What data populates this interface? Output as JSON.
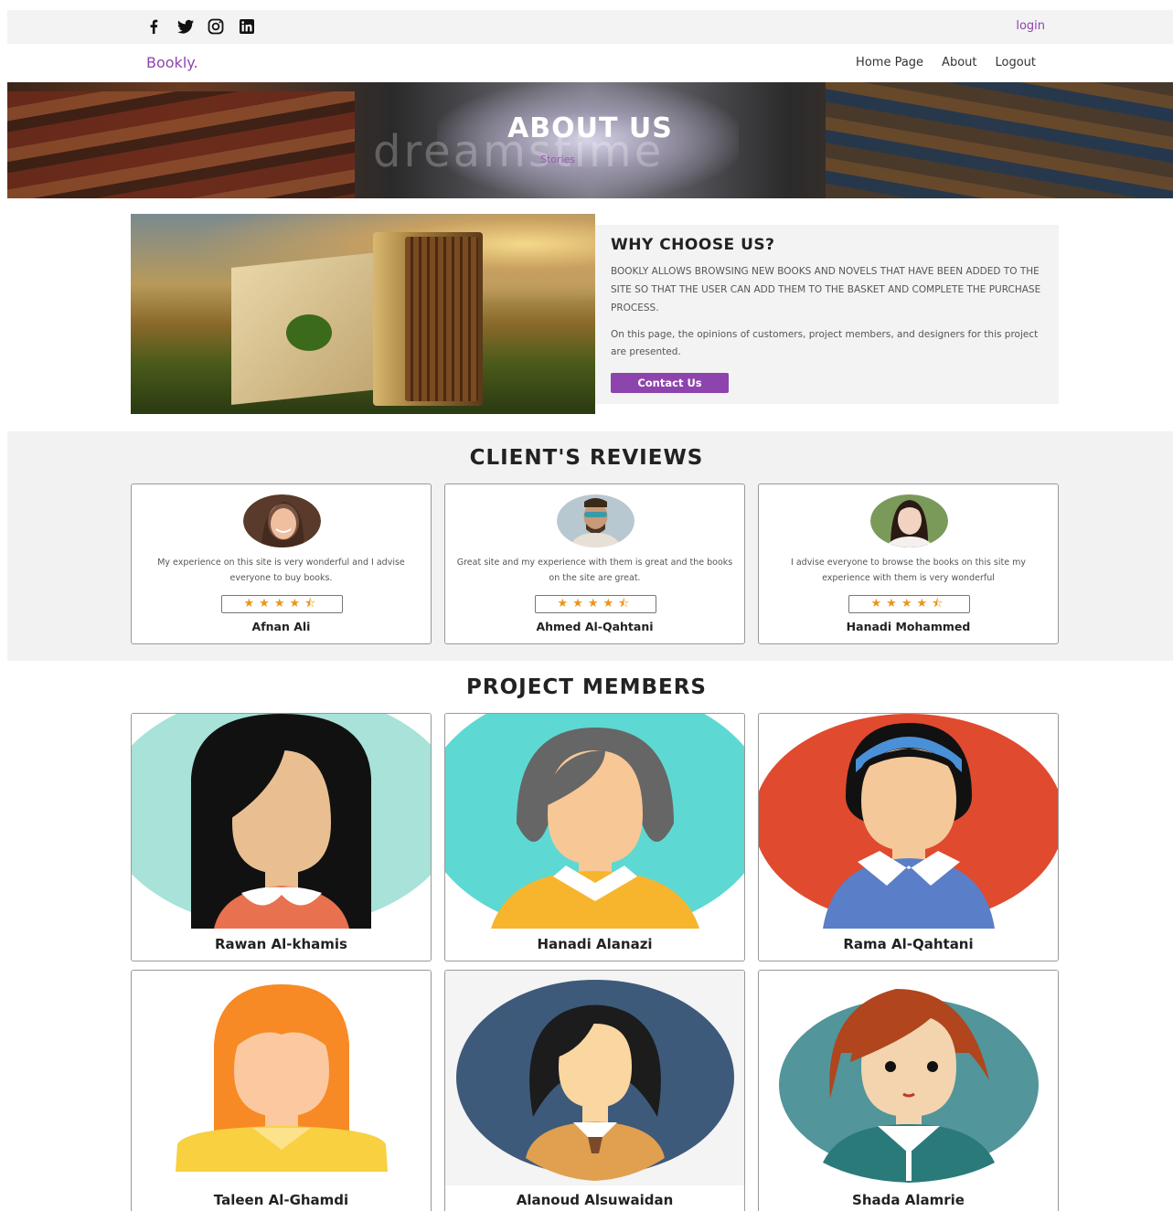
{
  "topbar": {
    "social_icons": [
      "facebook-icon",
      "twitter-icon",
      "instagram-icon",
      "linkedin-icon"
    ],
    "login_label": "login"
  },
  "nav": {
    "brand": "Bookly.",
    "links": [
      "Home Page",
      "About",
      "Logout"
    ]
  },
  "hero": {
    "title": "ABOUT US",
    "watermark": "dreamstime",
    "breadcrumb": "Stories"
  },
  "why": {
    "heading": "WHY CHOOSE US?",
    "paragraph1": "BOOKLY ALLOWS BROWSING NEW BOOKS AND NOVELS THAT HAVE BEEN ADDED TO THE SITE SO THAT THE USER CAN ADD THEM TO THE BASKET AND COMPLETE THE PURCHASE PROCESS.",
    "paragraph2": "On this page, the opinions of customers, project members, and designers for this project are presented.",
    "button_label": "Contact Us"
  },
  "reviews": {
    "heading": "CLIENT'S REVIEWS",
    "items": [
      {
        "text": "My experience on this site is very wonderful and I advise everyone to buy books.",
        "stars": "★★★★⯪",
        "rating": 4.5,
        "name": "Afnan Ali"
      },
      {
        "text": "Great site and my experience with them is great and the books on the site are great.",
        "stars": "★★★★⯪",
        "rating": 4.5,
        "name": "Ahmed Al-Qahtani"
      },
      {
        "text": "I advise everyone to browse the books on this site my experience with them is very wonderful",
        "stars": "★★★★⯪",
        "rating": 4.5,
        "name": "Hanadi Mohammed"
      }
    ]
  },
  "members": {
    "heading": "PROJECT MEMBERS",
    "items": [
      {
        "name": "Rawan Al-khamis"
      },
      {
        "name": "Hanadi Alanazi"
      },
      {
        "name": "Rama Al-Qahtani"
      },
      {
        "name": "Taleen Al-Ghamdi"
      },
      {
        "name": "Alanoud Alsuwaidan"
      },
      {
        "name": "Shada Alamrie"
      }
    ]
  },
  "colors": {
    "accent": "#8e44ad",
    "star": "#e8961c",
    "section_bg": "#f2f2f2"
  }
}
